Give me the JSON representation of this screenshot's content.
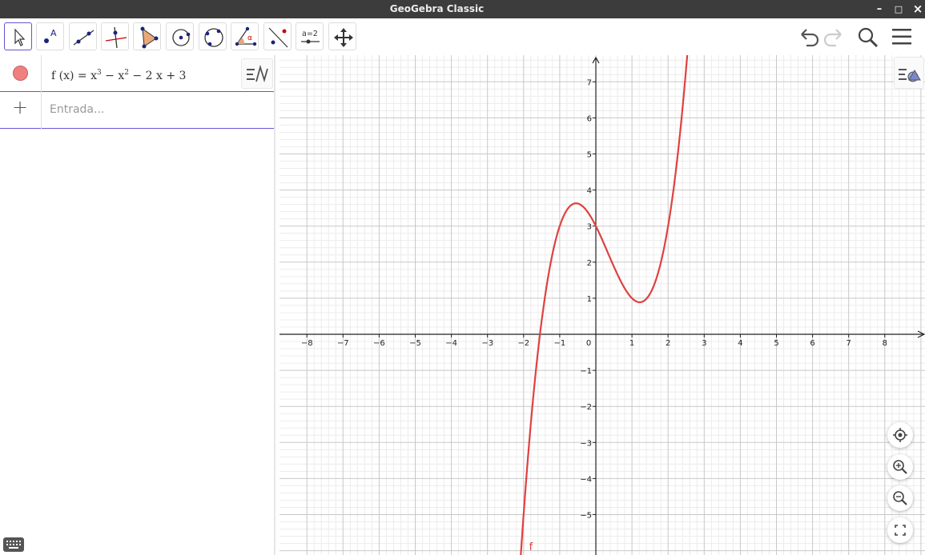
{
  "window": {
    "title": "GeoGebra Classic",
    "minimize": "–",
    "maximize": "□",
    "close": "×"
  },
  "toolbar": {
    "tools": [
      {
        "name": "move-tool",
        "label": "Move"
      },
      {
        "name": "point-tool",
        "label": "A"
      },
      {
        "name": "line-tool",
        "label": "Line"
      },
      {
        "name": "perpendicular-line-tool",
        "label": "Perpendicular Line"
      },
      {
        "name": "polygon-tool",
        "label": "Polygon"
      },
      {
        "name": "circle-center-point-tool",
        "label": "Circle"
      },
      {
        "name": "circle-three-points-tool",
        "label": "Circle through 3 points"
      },
      {
        "name": "angle-tool",
        "label": "α"
      },
      {
        "name": "reflect-tool",
        "label": "Reflect"
      },
      {
        "name": "slider-tool",
        "label": "a=2"
      },
      {
        "name": "move-graphics-tool",
        "label": "Move Graphics View"
      }
    ]
  },
  "algebra": {
    "object": {
      "name": "f",
      "prefix": "f (x)  =  x",
      "exp1": "3",
      "mid": " − x",
      "exp2": "2",
      "suffix": " − 2 x + 3",
      "color": "#e0403f"
    },
    "input_placeholder": "Entrada..."
  },
  "graphics": {
    "x_ticks": [
      "−8",
      "−7",
      "−6",
      "−5",
      "−4",
      "−3",
      "−2",
      "−1",
      "0",
      "1",
      "2",
      "3",
      "4",
      "5",
      "6",
      "7",
      "8"
    ],
    "y_ticks": [
      "7",
      "6",
      "5",
      "4",
      "3",
      "2",
      "1",
      "−1",
      "−2",
      "−3",
      "−4",
      "−5"
    ],
    "function_label": "f",
    "curve_color": "#e0403f"
  },
  "chart_data": {
    "type": "line",
    "title": "",
    "xlabel": "",
    "ylabel": "",
    "xlim": [
      -8.2,
      9.0
    ],
    "ylim": [
      -6.0,
      7.8
    ],
    "grid": true,
    "series": [
      {
        "name": "f",
        "function": "x^3 - x^2 - 2x + 3",
        "x": [
          -2,
          -1.5,
          -1,
          -0.55,
          0,
          0.5,
          1,
          1.22,
          1.5,
          2,
          2.5
        ],
        "y": [
          -5,
          0.375,
          3,
          3.63,
          3,
          1.875,
          1,
          0.88,
          1.125,
          3,
          6.375
        ]
      }
    ]
  }
}
